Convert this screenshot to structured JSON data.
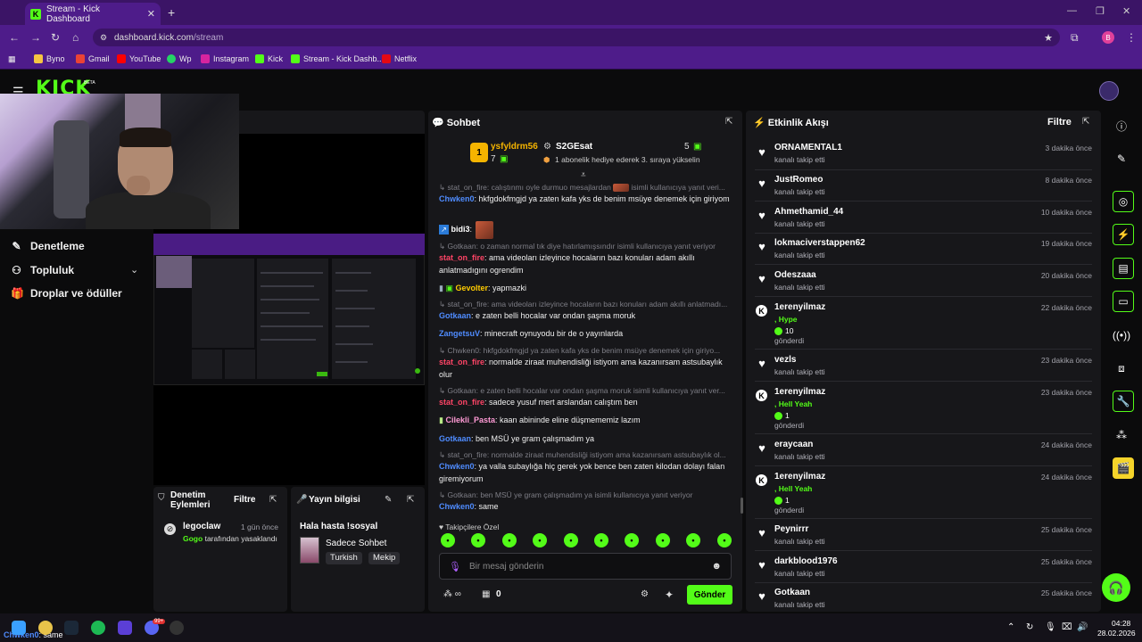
{
  "browser": {
    "tab_title": "Stream - Kick Dashboard",
    "url_host": "dashboard.kick.com",
    "url_path": "/stream",
    "profile_initial": "B",
    "bookmarks": [
      "Byno",
      "Gmail",
      "YouTube",
      "Wp",
      "Instagram",
      "Kick",
      "Stream - Kick Dashb...",
      "Netflix"
    ]
  },
  "kick": {
    "logo": "KICK",
    "beta": "BETA"
  },
  "sidebar": {
    "items": [
      "Denetleme",
      "Topluluk",
      "Droplar ve ödüller"
    ]
  },
  "stream_panel": {
    "title_fragment": "i"
  },
  "mod_panel": {
    "title_line1": "Denetim",
    "title_line2": "Eylemleri",
    "filter": "Filtre",
    "entry_user": "legoclaw",
    "entry_time": "1 gün önce",
    "entry_by": "Gogo",
    "entry_text": "tarafından yasaklandı"
  },
  "info_panel": {
    "title": "Yayın bilgisi",
    "stream_title": "Hala hasta !sosyal",
    "category": "Sadece Sohbet",
    "tags": [
      "Turkish",
      "Mekip"
    ]
  },
  "chat": {
    "title": "Sohbet",
    "podium": {
      "first_user": "ysfyldrm56",
      "first_count": "7",
      "second_user": "S2GEsat",
      "second_count": "5",
      "second_text": "1 abonelik hediye ederek 3. sıraya yükselin",
      "rank": "1"
    },
    "messages": [
      {
        "reply": "stat_on_fire: calıştınmı oyle durmuo mesajlardan",
        "reply_tail": "isimli kullanıcıya yanıt veri...",
        "user": "Chwken0",
        "color": "#4f8cff",
        "text": ": hkfgdokfmgjd ya zaten kafa yks de benim msüye denemek için giriyom"
      },
      {
        "user": "bidi3",
        "color": "#ffffff",
        "text": ":"
      },
      {
        "reply": "Gotkaan: o zaman normal tık diye hatırlamışsındır isimli kullanıcıya yanıt veriyor",
        "user": "stat_on_fire",
        "color": "#ff4466",
        "text": ": ama videoları izleyince hocaların bazı konuları adam akıllı anlatmadıgını ogrendim"
      },
      {
        "user": "Gevolter",
        "color": "#ffcc00",
        "text": ": yapmazki"
      },
      {
        "reply": "stat_on_fire: ama videoları izleyince hocaların bazı konuları adam akıllı anlatmadı...",
        "user": "Gotkaan",
        "color": "#4f8cff",
        "text": ": e zaten belli hocalar var ondan şaşma moruk"
      },
      {
        "user": "ZangetsuV",
        "color": "#4f8cff",
        "text": ": minecraft oynuyodu bir de o yayınlarda"
      },
      {
        "reply": "Chwken0: hkfgdokfmgjd ya zaten kafa yks de benim msüye denemek için giriyo...",
        "user": "stat_on_fire",
        "color": "#ff4466",
        "text": ": normalde ziraat muhendisliği istiyom ama kazanırsam astsubaylık olur"
      },
      {
        "reply": "Gotkaan: e zaten belli hocalar var ondan şaşma moruk isimli kullanıcıya yanıt ver...",
        "user": "stat_on_fire",
        "color": "#ff4466",
        "text": ": sadece yusuf mert arslandan calıştım ben"
      },
      {
        "user": "Cilekli_Pasta",
        "color": "#ff9ad5",
        "text": ": kaan abininde eline düşmememiz lazım"
      },
      {
        "user": "Gotkaan",
        "color": "#4f8cff",
        "text": ": ben MSÜ ye gram çalışmadım ya"
      },
      {
        "reply": "stat_on_fire: normalde ziraat muhendisliği istiyom ama kazanırsam astsubaylık ol...",
        "user": "Chwken0",
        "color": "#4f8cff",
        "text": ": ya valla subaylığa hiç gerek yok bence ben zaten kilodan dolayı falan giremiyorum"
      },
      {
        "reply": "Gotkaan: ben MSÜ ye gram çalışmadım ya isimli kullanıcıya yanıt veriyor",
        "user": "Chwken0",
        "color": "#4f8cff",
        "text": ": same"
      }
    ],
    "followers_only": "Takipçilere Özel",
    "input_placeholder": "Bir mesaj gönderin",
    "points": "0",
    "send": "Gönder"
  },
  "activity": {
    "title": "Etkinlik Akışı",
    "filter": "Filtre",
    "items": [
      {
        "type": "follow",
        "name": "ORNAMENTAL1",
        "sub": "kanalı takip etti",
        "time": "3 dakika önce"
      },
      {
        "type": "follow",
        "name": "JustRomeo",
        "sub": "kanalı takip etti",
        "time": "8 dakika önce"
      },
      {
        "type": "follow",
        "name": "Ahmethamid_44",
        "sub": "kanalı takip etti",
        "time": "10 dakika önce"
      },
      {
        "type": "follow",
        "name": "lokmaciverstappen62",
        "sub": "kanalı takip etti",
        "time": "19 dakika önce"
      },
      {
        "type": "follow",
        "name": "Odeszaaa",
        "sub": "kanalı takip etti",
        "time": "20 dakika önce"
      },
      {
        "type": "kicks",
        "name": "1erenyilmaz",
        "hype": ", Hype",
        "amount": "10",
        "sub": "gönderdi",
        "time": "22 dakika önce"
      },
      {
        "type": "follow",
        "name": "vezls",
        "sub": "kanalı takip etti",
        "time": "23 dakika önce"
      },
      {
        "type": "kicks",
        "name": "1erenyilmaz",
        "hype": ", Hell Yeah",
        "amount": "1",
        "sub": "gönderdi",
        "time": "23 dakika önce"
      },
      {
        "type": "follow",
        "name": "eraycaan",
        "sub": "kanalı takip etti",
        "time": "24 dakika önce"
      },
      {
        "type": "kicks",
        "name": "1erenyilmaz",
        "hype": ", Hell Yeah",
        "amount": "1",
        "sub": "gönderdi",
        "time": "24 dakika önce"
      },
      {
        "type": "follow",
        "name": "Peynirrr",
        "sub": "kanalı takip etti",
        "time": "25 dakika önce"
      },
      {
        "type": "follow",
        "name": "darkblood1976",
        "sub": "kanalı takip etti",
        "time": "25 dakika önce"
      },
      {
        "type": "follow",
        "name": "Gotkaan",
        "sub": "kanalı takip etti",
        "time": "25 dakika önce"
      }
    ]
  },
  "taskbar": {
    "ticker_user": "Chwken0",
    "ticker_text": ": same",
    "time": "04:28",
    "date": "28.02.2026",
    "badge": "99+"
  }
}
